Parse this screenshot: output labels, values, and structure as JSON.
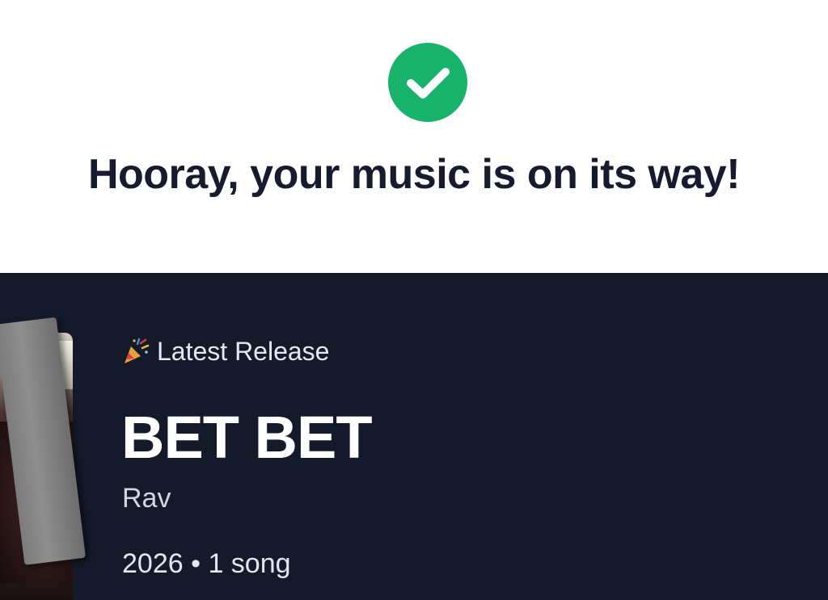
{
  "header": {
    "status_icon": "check-icon",
    "status_color": "#18b36b",
    "message": "Hooray, your music is on its way!"
  },
  "release": {
    "badge_icon": "party-popper-icon",
    "badge_label": "Latest Release",
    "title": "BET BET",
    "artist": "Rav",
    "year": "2026",
    "separator": "•",
    "song_count": "1 song"
  },
  "colors": {
    "panel_background": "#151a2b",
    "heading_text": "#161b2e"
  }
}
